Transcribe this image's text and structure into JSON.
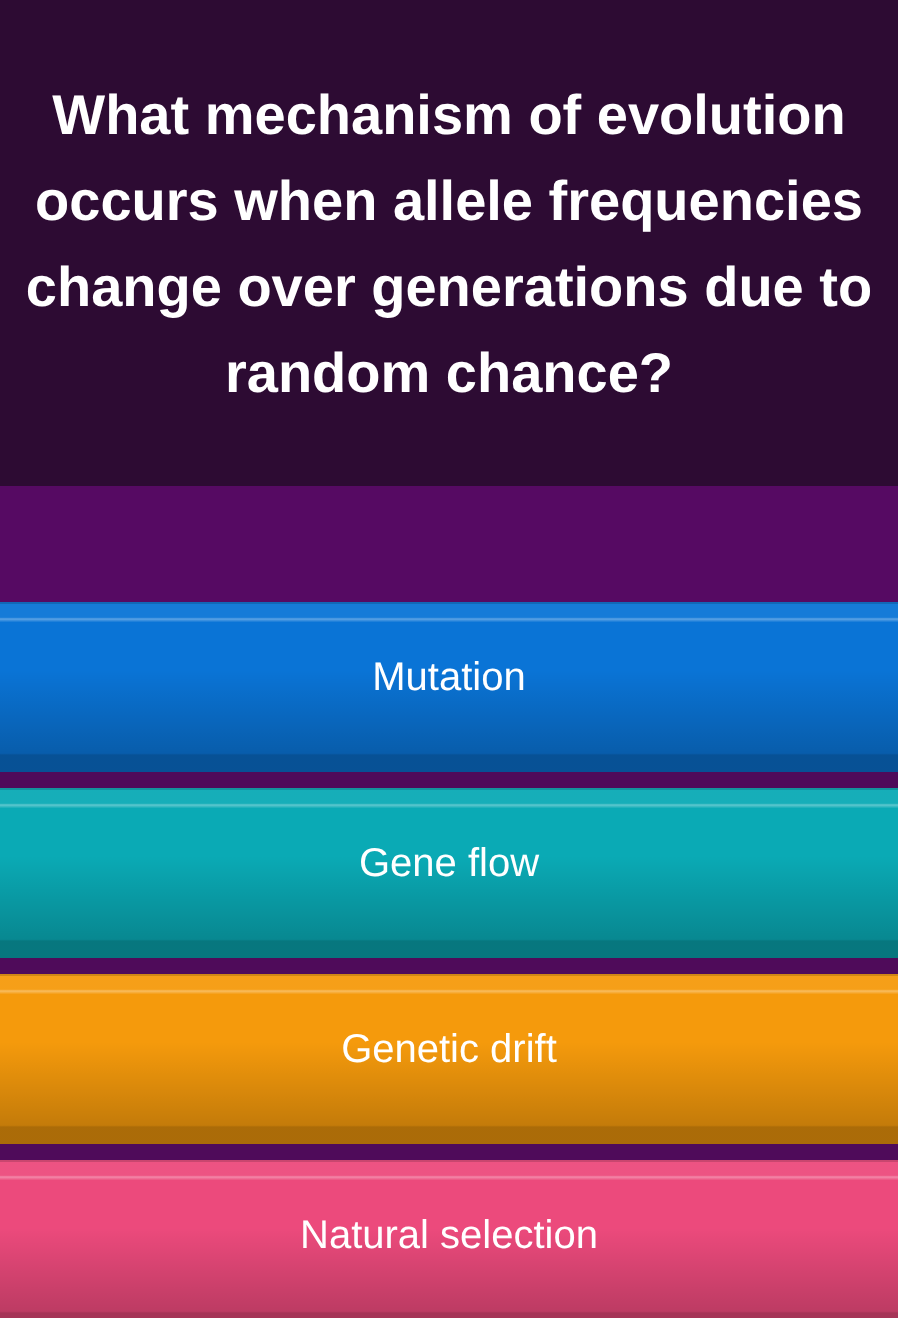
{
  "question": "What mechanism of evolution occurs when allele frequencies change over generations due to random chance?",
  "options": [
    {
      "label": "Mutation",
      "color": "#0a74d6"
    },
    {
      "label": "Gene flow",
      "color": "#0aaab5"
    },
    {
      "label": "Genetic drift",
      "color": "#f59a0c"
    },
    {
      "label": "Natural selection",
      "color": "#ec4a7c"
    }
  ]
}
